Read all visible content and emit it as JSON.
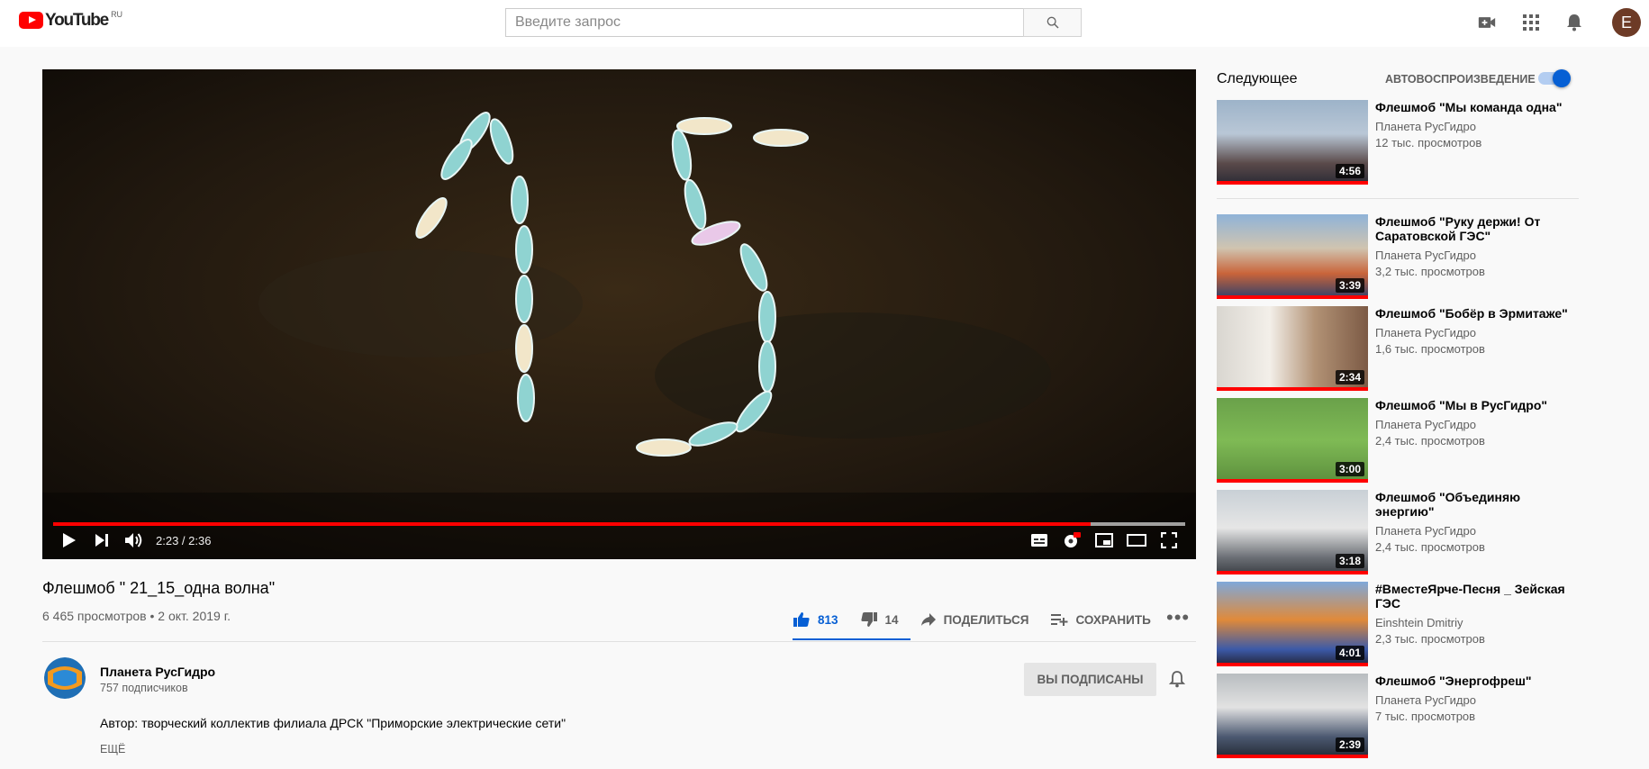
{
  "header": {
    "logo_text": "YouTube",
    "logo_region": "RU",
    "search_placeholder": "Введите запрос",
    "avatar_letter": "E"
  },
  "player": {
    "time": "2:23 / 2:36",
    "progress_fraction": 0.9167
  },
  "video": {
    "title": "Флешмоб \" 21_15_одна волна\"",
    "meta": "6 465 просмотров • 2 окт. 2019 г.",
    "likes": "813",
    "dislikes": "14",
    "share_label": "ПОДЕЛИТЬСЯ",
    "save_label": "СОХРАНИТЬ",
    "more": "•••"
  },
  "channel": {
    "name": "Планета РусГидро",
    "subscribers": "757 подписчиков",
    "subscribed_label": "ВЫ ПОДПИСАНЫ",
    "description": "Автор: творческий коллектив филиала ДРСК \"Приморские электрические сети\"",
    "more_label": "ЕЩЁ"
  },
  "sidebar": {
    "up_next": "Следующее",
    "autoplay_label": "АВТОВОСПРОИЗВЕДЕНИЕ",
    "autoplay_on": true,
    "items": [
      {
        "title": "Флешмоб \"Мы команда одна\"",
        "channel": "Планета РусГидро",
        "views": "12 тыс. просмотров",
        "duration": "4:56"
      },
      {
        "title": "Флешмоб \"Руку держи! От Саратовской ГЭС\"",
        "channel": "Планета РусГидро",
        "views": "3,2 тыс. просмотров",
        "duration": "3:39"
      },
      {
        "title": "Флешмоб \"Бобёр в Эрмитаже\"",
        "channel": "Планета РусГидро",
        "views": "1,6 тыс. просмотров",
        "duration": "2:34"
      },
      {
        "title": "Флешмоб \"Мы в РусГидро\"",
        "channel": "Планета РусГидро",
        "views": "2,4 тыс. просмотров",
        "duration": "3:00"
      },
      {
        "title": "Флешмоб \"Объединяю энергию\"",
        "channel": "Планета РусГидро",
        "views": "2,4 тыс. просмотров",
        "duration": "3:18"
      },
      {
        "title": "#ВместеЯрче-Песня _ Зейская ГЭС",
        "channel": "Einshtein Dmitriy",
        "views": "2,3 тыс. просмотров",
        "duration": "4:01"
      },
      {
        "title": "Флешмоб \"Энергофреш\"",
        "channel": "Планета РусГидро",
        "views": "7 тыс. просмотров",
        "duration": "2:39"
      }
    ]
  },
  "colors": {
    "brand_red": "#ff0000",
    "accent_blue": "#065fd4",
    "text_secondary": "#606060"
  }
}
